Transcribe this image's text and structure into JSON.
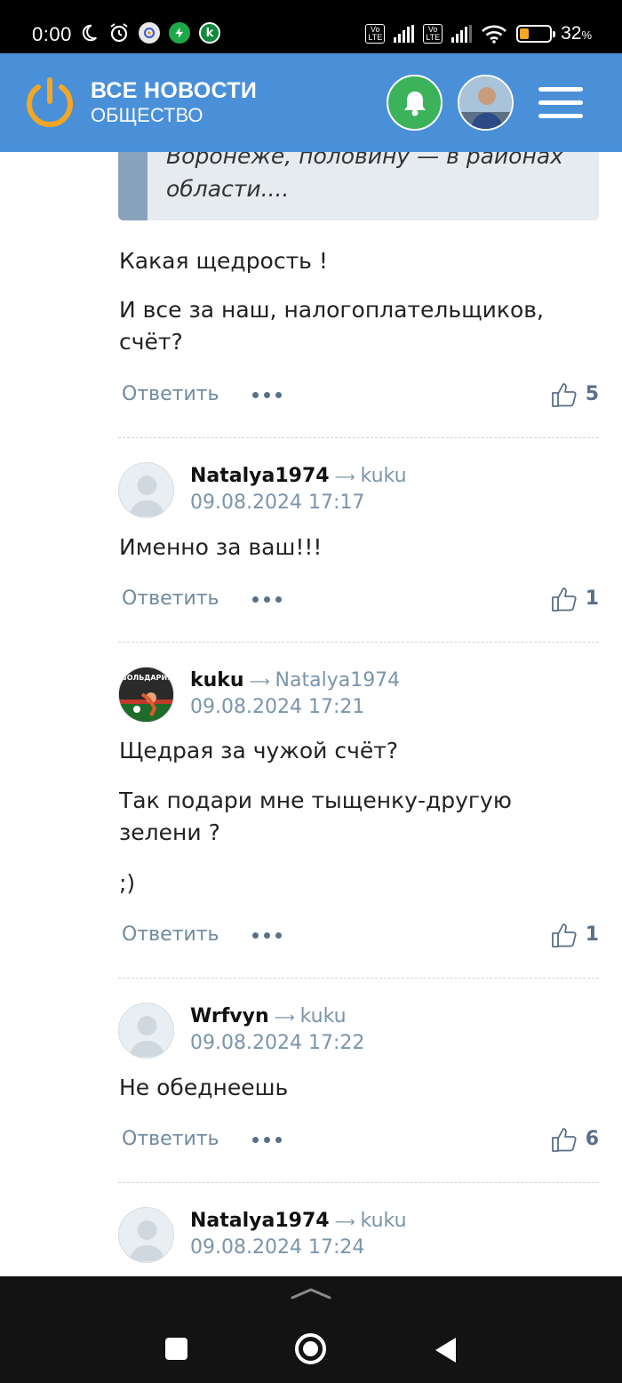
{
  "status_bar": {
    "time": "0:00",
    "battery_percent": "32",
    "battery_level": 0.32,
    "percent_sign": "%",
    "volte1": "Vo LTE",
    "volte2": "Vo LTE",
    "icons": [
      "moon-icon",
      "alarm-icon",
      "mail-app-icon",
      "shield-app-icon",
      "k-app-icon",
      "signal-icon",
      "wifi-icon",
      "battery-icon"
    ]
  },
  "header": {
    "title": "ВСЕ НОВОСТИ",
    "section": "ОБЩЕСТВО",
    "accent": "#4a90d9",
    "logo_color": "#f5a623",
    "bell_color": "#3cb35a"
  },
  "quote": {
    "text": "Воронеже, половину — в районах области...."
  },
  "first_comment": {
    "lines": [
      "Какая щедрость !",
      "И все за наш, налогоплательщиков, счёт?"
    ],
    "reply_label": "Ответить",
    "likes": "5"
  },
  "comments": [
    {
      "author": "Natalya1974",
      "reply_to": "kuku",
      "date": "09.08.2024 17:17",
      "lines": [
        "Именно за ваш!!!"
      ],
      "reply_label": "Ответить",
      "likes": "1"
    },
    {
      "author": "kuku",
      "reply_to": "Natalya1974",
      "date": "09.08.2024 17:21",
      "avatar_text": "ВОЛЬДАРИЯ",
      "lines": [
        "Щедрая за чужой счёт?",
        "Так подари мне тыщенку-другую зелени ?",
        ";)"
      ],
      "reply_label": "Ответить",
      "likes": "1"
    },
    {
      "author": "Wrfvyn",
      "reply_to": "kuku",
      "date": "09.08.2024 17:22",
      "lines": [
        "Не обеднеешь"
      ],
      "reply_label": "Ответить",
      "likes": "6"
    },
    {
      "author": "Natalya1974",
      "reply_to": "kuku",
      "date": "09.08.2024 17:24"
    }
  ],
  "arrow": "⟶"
}
